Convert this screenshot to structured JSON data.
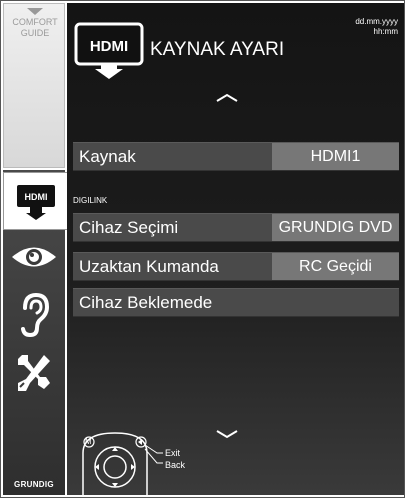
{
  "guide": {
    "line1": "COMFORT",
    "line2": "GUIDE"
  },
  "header": {
    "title": "KAYNAK AYARI",
    "date": "dd.mm.yyyy",
    "time": "hh:mm",
    "icon": "hdmi-icon"
  },
  "sidebar": {
    "items": [
      {
        "name": "hdmi",
        "icon": "hdmi-icon",
        "active": true
      },
      {
        "name": "picture",
        "icon": "eye-icon",
        "active": false
      },
      {
        "name": "sound",
        "icon": "ear-icon",
        "active": false
      },
      {
        "name": "tools",
        "icon": "tools-icon",
        "active": false
      }
    ],
    "brand": "GRUNDIG"
  },
  "menu": {
    "source": {
      "label": "Kaynak",
      "value": "HDMI1"
    },
    "section": "DIGILINK",
    "device": {
      "label": "Cihaz Seçimi",
      "value": "GRUNDIG DVD"
    },
    "remote": {
      "label": "Uzaktan Kumanda",
      "value": "RC Geçidi"
    },
    "standby": {
      "label": "Cihaz Beklemede"
    }
  },
  "remote_hint": {
    "m": "M",
    "exit": "Exit",
    "back": "Back"
  },
  "colors": {
    "highlight": "#777777",
    "row": "#4a4a4a",
    "sidebar": "#3a3a3a"
  }
}
